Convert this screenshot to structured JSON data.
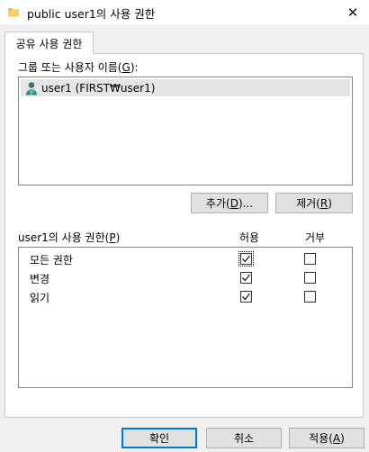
{
  "window": {
    "title": "public user1의 사용 권한",
    "close_glyph": "✕"
  },
  "tab": {
    "label": "공유 사용 권한"
  },
  "group_section": {
    "label_prefix": "그룹 또는 사용자 이름(",
    "label_key": "G",
    "label_suffix": "):",
    "users": [
      {
        "name": "user1 (FIRST₩user1)",
        "icon": "user-icon"
      }
    ]
  },
  "buttons": {
    "add": {
      "prefix": "추가(",
      "key": "D",
      "suffix": ")..."
    },
    "remove": {
      "prefix": "제거(",
      "key": "R",
      "suffix": ")"
    },
    "ok": {
      "label": "확인"
    },
    "cancel": {
      "label": "취소"
    },
    "apply": {
      "prefix": "적용(",
      "key": "A",
      "suffix": ")"
    }
  },
  "permissions": {
    "label_prefix": "user1의 사용 권한(",
    "label_key": "P",
    "label_suffix": ")",
    "allow_header": "허용",
    "deny_header": "거부",
    "rows": [
      {
        "name": "모든 권한",
        "allow": true,
        "deny": false
      },
      {
        "name": "변경",
        "allow": true,
        "deny": false
      },
      {
        "name": "읽기",
        "allow": true,
        "deny": false
      }
    ]
  },
  "colors": {
    "accent": "#0078d7",
    "selection": "#e5e5e5",
    "button_face": "#e1e1e1"
  }
}
